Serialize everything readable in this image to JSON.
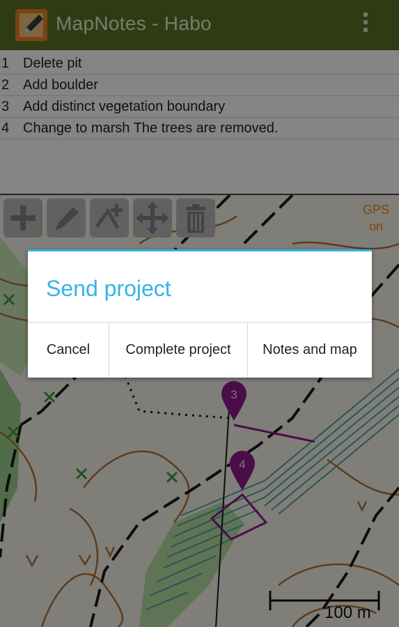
{
  "actionbar": {
    "app_icon": "pencil-note-icon",
    "title": "MapNotes - Habo",
    "overflow_icon": "overflow-menu-icon"
  },
  "notes": [
    {
      "num": "1",
      "text": "Delete pit"
    },
    {
      "num": "2",
      "text": "Add boulder"
    },
    {
      "num": "3",
      "text": "Add distinct vegetation boundary"
    },
    {
      "num": "4",
      "text": "Change to marsh The trees are removed."
    }
  ],
  "toolbar": {
    "tools": [
      "add-icon",
      "pencil-icon",
      "add-path-icon",
      "move-icon",
      "trash-icon"
    ],
    "gps_line1": "GPS",
    "gps_line2": "on"
  },
  "map": {
    "markers": [
      "3",
      "4"
    ],
    "scale_label": "100 m"
  },
  "dialog": {
    "title": "Send project",
    "buttons": [
      "Cancel",
      "Complete project",
      "Notes and map"
    ]
  },
  "colors": {
    "actionbar": "#5b7326",
    "dialog_accent": "#33b5e5",
    "marker": "#8e1a8e",
    "gps": "#e88a1a"
  }
}
